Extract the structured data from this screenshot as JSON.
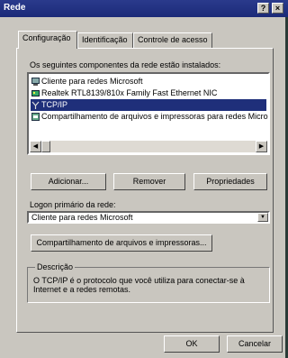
{
  "window": {
    "title": "Rede",
    "help_button": "?",
    "close_button": "×"
  },
  "tabs": [
    {
      "label": "Configuração"
    },
    {
      "label": "Identificação"
    },
    {
      "label": "Controle de acesso"
    }
  ],
  "components_label": "Os seguintes componentes da rede estão instalados:",
  "components": [
    {
      "label": "Cliente para redes Microsoft",
      "icon": "client-icon"
    },
    {
      "label": "Realtek RTL8139/810x Family Fast Ethernet NIC",
      "icon": "network-adapter-icon"
    },
    {
      "label": "TCP/IP",
      "icon": "protocol-icon",
      "selected": true
    },
    {
      "label": "Compartilhamento de arquivos e impressoras para redes Micro",
      "icon": "service-icon"
    }
  ],
  "scroll": {
    "left_arrow": "◀",
    "right_arrow": "▶"
  },
  "buttons": {
    "add": "Adicionar...",
    "remove": "Remover",
    "properties": "Propriedades"
  },
  "logon": {
    "label": "Logon primário da rede:",
    "value": "Cliente para redes Microsoft",
    "arrow": "▼"
  },
  "file_sharing_button": "Compartilhamento de arquivos e impressoras...",
  "description": {
    "legend": "Descrição",
    "text": "O TCP/IP é o protocolo que você utiliza para conectar-se à Internet e a redes remotas."
  },
  "footer": {
    "ok": "OK",
    "cancel": "Cancelar"
  },
  "colors": {
    "title_bar": "#1b2a78",
    "selection": "#1f2f7a",
    "window_face": "#c9c6bf"
  }
}
